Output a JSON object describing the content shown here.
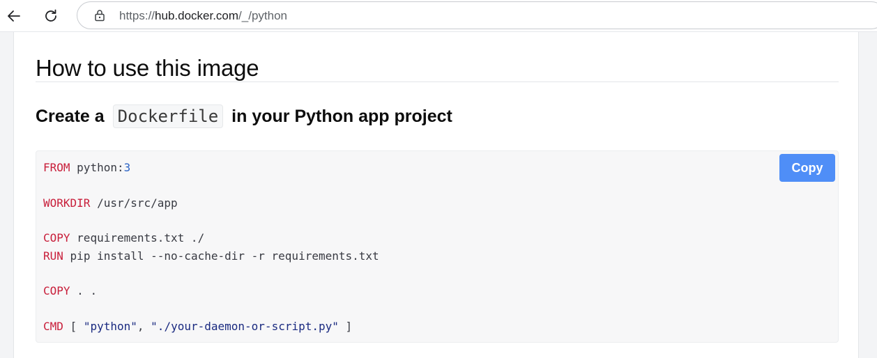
{
  "browser": {
    "url": {
      "scheme": "https://",
      "host": "hub.docker.com",
      "path": "/_/python"
    }
  },
  "section": {
    "heading": "How to use this image",
    "subheading": {
      "before": "Create a",
      "code": "Dockerfile",
      "after": "in your Python app project"
    }
  },
  "code_block": {
    "copy_label": "Copy",
    "lines": [
      {
        "kw": "FROM",
        "rest": "python:",
        "num": "3"
      },
      {
        "kw": "WORKDIR",
        "rest": "/usr/src/app"
      },
      {
        "kw": "COPY",
        "rest": "requirements.txt ./"
      },
      {
        "kw": "RUN",
        "rest": "pip install --no-cache-dir -r requirements.txt"
      },
      {
        "kw": "COPY",
        "rest": ". ."
      },
      {
        "kw": "CMD",
        "open": "[",
        "str1": "\"python\"",
        "sep": ",",
        "str2": "\"./your-daemon-or-script.py\"",
        "close": "]"
      }
    ]
  },
  "icons": {
    "back": "back-arrow-icon",
    "reload": "reload-icon",
    "lock": "lock-icon"
  },
  "colors": {
    "keyword": "#c81e3a",
    "number": "#2b63c5",
    "string": "#1a2a80",
    "copy_button": "#4f8ef7"
  }
}
